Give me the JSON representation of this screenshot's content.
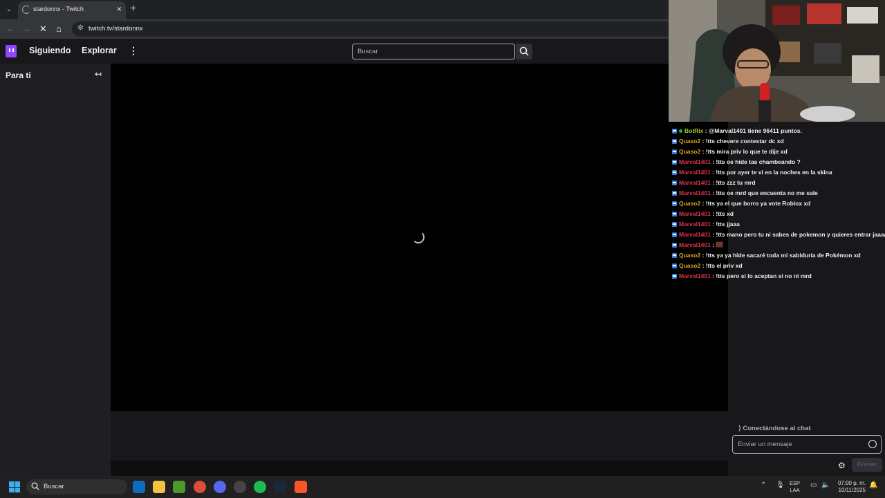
{
  "browser": {
    "tab_title": "stardonnx - Twitch",
    "url": "twitch.tv/stardonnx"
  },
  "twitch": {
    "nav": {
      "following": "Siguiendo",
      "explore": "Explorar"
    },
    "search_placeholder": "Buscar",
    "sidebar_title": "Para ti"
  },
  "chat": {
    "messages": [
      {
        "user": "BotRix",
        "text": ": @Marval1401 tiene 96411 puntos."
      },
      {
        "user": "Quaso2",
        "text": ": !tts chevere contestar dc xd"
      },
      {
        "user": "Quaso2",
        "text": ": !tts mira priv lo que te dije xd"
      },
      {
        "user": "Marval1401",
        "text": ": !tts oe hide tas chambeando ?"
      },
      {
        "user": "Marval1401",
        "text": ": !tts por ayer te vi en la noches en la skina"
      },
      {
        "user": "Marval1401",
        "text": ": !tts zzz tu mrd"
      },
      {
        "user": "Marval1401",
        "text": ": !tts oe mrd que encuenta no me sale"
      },
      {
        "user": "Quaso2",
        "text": ": !tts ya el que borro ya vote Roblox xd"
      },
      {
        "user": "Marval1401",
        "text": ": !tts xd"
      },
      {
        "user": "Marval1401",
        "text": ": !tts jjaaa"
      },
      {
        "user": "Marval1401",
        "text": ": !tts mano pero tu ni sabes de pokemon y quieres entrar jaaaa"
      },
      {
        "user": "Marval1401",
        "text": ":"
      },
      {
        "user": "Quaso2",
        "text": ": !tts ya ya hide sacaré toda mi sabiduría de Pokémon xd"
      },
      {
        "user": "Quaso2",
        "text": ": !tts el priv xd"
      },
      {
        "user": "Marval1401",
        "text": ": !tts pero si lo aceptan si no ni mrd"
      }
    ],
    "connecting": "Conectándose al chat",
    "input_placeholder": "Enviar un mensaje",
    "send_label": "Enviar"
  },
  "taskbar": {
    "search_label": "Buscar",
    "lang_top": "ESP",
    "lang_bottom": "LAA",
    "time": "07:00 p. m.",
    "date": "10/11/2025"
  },
  "colors": {
    "twitch_purple": "#9147ff",
    "user_marval": "#e0344d",
    "user_quaso": "#daa520",
    "user_botrix": "#9acd32"
  }
}
